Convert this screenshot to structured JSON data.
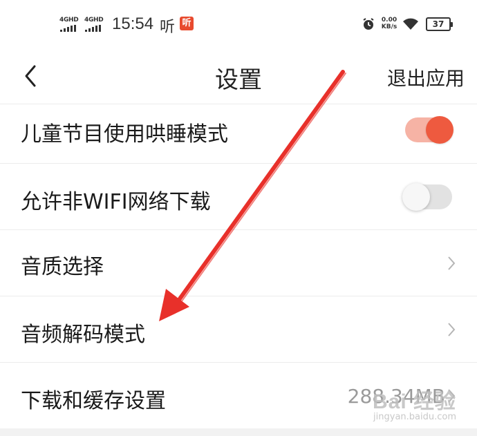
{
  "status_bar": {
    "network_1": "4GHD",
    "network_2": "4GHD",
    "time": "15:54",
    "notif_text": "听",
    "app_badge": "听",
    "speed_value": "0.00",
    "speed_unit": "KB/s",
    "battery_level": "37",
    "icons": [
      "alarm-icon",
      "wifi-icon",
      "battery-icon",
      "signal-icon"
    ]
  },
  "navbar": {
    "back_icon": "chevron-left-icon",
    "title": "设置",
    "exit_label": "退出应用"
  },
  "settings": {
    "items": [
      {
        "label": "儿童节目使用哄睡模式",
        "control": "toggle",
        "state": "on"
      },
      {
        "label": "允许非WIFI网络下载",
        "control": "toggle",
        "state": "off"
      },
      {
        "label": "音质选择",
        "control": "chevron"
      },
      {
        "label": "音频解码模式",
        "control": "chevron"
      },
      {
        "label": "下载和缓存设置",
        "control": "chevron",
        "value": "288.34MB"
      }
    ]
  },
  "colors": {
    "accent": "#ee5a3f",
    "toggle_on_track": "#f6b3a5",
    "toggle_off_track": "#e2e2e2",
    "annotation_arrow": "#e8302a",
    "value_text": "#9a9a9a"
  },
  "watermark": {
    "logo": "Bai 经验",
    "url": "jingyan.baidu.com"
  }
}
